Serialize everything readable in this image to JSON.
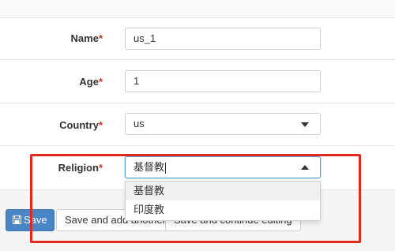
{
  "form": {
    "fields": [
      {
        "label": "Name",
        "required_mark": "*",
        "value": "us_1"
      },
      {
        "label": "Age",
        "required_mark": "*",
        "value": "1"
      },
      {
        "label": "Country",
        "required_mark": "*",
        "value": "us"
      },
      {
        "label": "Religion",
        "required_mark": "*",
        "value": "基督教"
      }
    ]
  },
  "religion_dropdown": {
    "options": [
      "基督教",
      "印度教"
    ]
  },
  "actions": {
    "save_label": "Save",
    "save_add_another_label": "Save and add another",
    "save_continue_label": "Save and continue editing"
  },
  "colors": {
    "primary_button": "#4a86c5",
    "required_mark": "#c9302c",
    "highlight_box": "#e3291c"
  }
}
